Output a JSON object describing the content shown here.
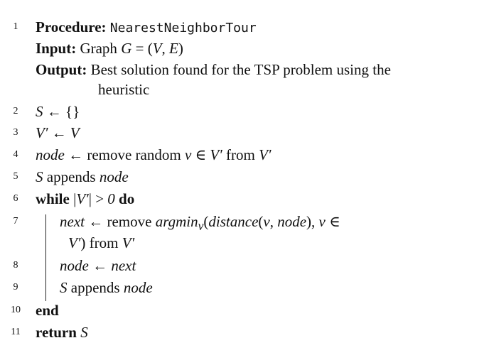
{
  "algorithm": {
    "lines": [
      {
        "num": "1",
        "parts": [
          {
            "text": "Procedure:",
            "style": "kw"
          },
          {
            "text": " ",
            "style": ""
          },
          {
            "text": "NearestNeighborTour",
            "style": "mono"
          }
        ]
      },
      {
        "num": "",
        "parts": [
          {
            "text": "Input:",
            "style": "kw"
          },
          {
            "text": " Graph ",
            "style": ""
          },
          {
            "text": "G",
            "style": "it"
          },
          {
            "text": " = (",
            "style": ""
          },
          {
            "text": "V",
            "style": "it"
          },
          {
            "text": ", ",
            "style": ""
          },
          {
            "text": "E",
            "style": "it"
          },
          {
            "text": ")",
            "style": ""
          }
        ]
      },
      {
        "num": "",
        "parts": [
          {
            "text": "Output:",
            "style": "kw"
          },
          {
            "text": " Best solution found for the TSP problem using the",
            "style": ""
          }
        ]
      },
      {
        "num": "",
        "parts": [
          {
            "text": "heuristic",
            "style": ""
          }
        ]
      },
      {
        "num": "2",
        "parts": [
          {
            "text": "S",
            "style": "it"
          },
          {
            "text": " ← {}",
            "style": ""
          }
        ]
      },
      {
        "num": "3",
        "parts": [
          {
            "text": "V′",
            "style": "it"
          },
          {
            "text": " ← ",
            "style": ""
          },
          {
            "text": "V",
            "style": "it"
          }
        ]
      },
      {
        "num": "4",
        "parts": [
          {
            "text": "node",
            "style": "it"
          },
          {
            "text": " ←  remove random ",
            "style": ""
          },
          {
            "text": "v",
            "style": "it"
          },
          {
            "text": " ∈ ",
            "style": ""
          },
          {
            "text": "V′",
            "style": "it"
          },
          {
            "text": " from ",
            "style": ""
          },
          {
            "text": "V′",
            "style": "it"
          }
        ]
      },
      {
        "num": "5",
        "parts": [
          {
            "text": "S",
            "style": "it"
          },
          {
            "text": " appends ",
            "style": ""
          },
          {
            "text": "node",
            "style": "it"
          }
        ]
      },
      {
        "num": "6",
        "parts": [
          {
            "text": "while",
            "style": "kw"
          },
          {
            "text": " |",
            "style": ""
          },
          {
            "text": "V′",
            "style": "it"
          },
          {
            "text": "| > ",
            "style": ""
          },
          {
            "text": "0",
            "style": "it"
          },
          {
            "text": " ",
            "style": ""
          },
          {
            "text": "do",
            "style": "kw"
          }
        ]
      },
      {
        "num": "7",
        "parts": [
          {
            "text": "next",
            "style": "it"
          },
          {
            "text": " ←  remove ",
            "style": ""
          },
          {
            "text": "argmin",
            "style": "it"
          },
          {
            "text": "v",
            "style": "it"
          },
          {
            "text": "(",
            "style": ""
          },
          {
            "text": "distance",
            "style": "it"
          },
          {
            "text": "(",
            "style": ""
          },
          {
            "text": "v",
            "style": "it"
          },
          {
            "text": ", ",
            "style": ""
          },
          {
            "text": "node",
            "style": "it"
          },
          {
            "text": "), ",
            "style": ""
          },
          {
            "text": "v",
            "style": "it"
          },
          {
            "text": " ∈",
            "style": ""
          }
        ]
      },
      {
        "num": "",
        "parts": [
          {
            "text": "V′",
            "style": "it"
          },
          {
            "text": ") from ",
            "style": ""
          },
          {
            "text": "V′",
            "style": "it"
          }
        ]
      },
      {
        "num": "8",
        "parts": [
          {
            "text": "node",
            "style": "it"
          },
          {
            "text": " ← ",
            "style": ""
          },
          {
            "text": "next",
            "style": "it"
          }
        ]
      },
      {
        "num": "9",
        "parts": [
          {
            "text": "S",
            "style": "it"
          },
          {
            "text": " appends ",
            "style": ""
          },
          {
            "text": "node",
            "style": "it"
          }
        ]
      },
      {
        "num": "10",
        "parts": [
          {
            "text": "end",
            "style": "kw"
          }
        ]
      },
      {
        "num": "11",
        "parts": [
          {
            "text": "return",
            "style": "kw"
          },
          {
            "text": " ",
            "style": ""
          },
          {
            "text": "S",
            "style": "it"
          }
        ]
      }
    ]
  }
}
